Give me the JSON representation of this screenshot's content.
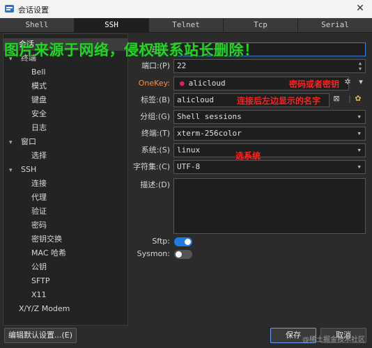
{
  "window": {
    "title": "会话设置",
    "close": "✕"
  },
  "tabs": [
    {
      "label": "Shell",
      "active": false
    },
    {
      "label": "SSH",
      "active": true
    },
    {
      "label": "Telnet",
      "active": false
    },
    {
      "label": "Tcp",
      "active": false
    },
    {
      "label": "Serial",
      "active": false
    }
  ],
  "tree": {
    "session": "会话",
    "terminal": "终端",
    "terminal_children": [
      "Bell",
      "模式",
      "键盘",
      "安全",
      "日志"
    ],
    "window": "窗口",
    "window_children": [
      "选择"
    ],
    "ssh": "SSH",
    "ssh_children": [
      "连接",
      "代理",
      "验证",
      "密码",
      "密钥交换",
      "MAC 哈希",
      "公钥",
      "SFTP",
      "X11"
    ],
    "xyz": "X/Y/Z Modem"
  },
  "form": {
    "host_label": "主机:",
    "host_value": "",
    "port_label": "端口:(P)",
    "port_value": "22",
    "onekey_label": "OneKey:",
    "onekey_value": "alicloud",
    "tag_label": "标签:(B)",
    "tag_value": "alicloud",
    "group_label": "分组:(G)",
    "group_value": "Shell sessions",
    "terminal_label": "终端:(T)",
    "terminal_value": "xterm-256color",
    "system_label": "系统:(S)",
    "system_value": "linux",
    "charset_label": "字符集:(C)",
    "charset_value": "UTF-8",
    "desc_label": "描述:(D)",
    "desc_value": "",
    "sftp_label": "Sftp:",
    "sftp_on": true,
    "sysmon_label": "Sysmon:",
    "sysmon_on": false
  },
  "annotations": {
    "key_note": "密码或者密钥",
    "tag_note": "连接后左边显示的名字",
    "system_note": "选系统"
  },
  "watermark": "图片来源于网络，侵权联系站长删除！",
  "footer_watermark": "@稀土掘金技术社区",
  "buttons": {
    "edit_defaults": "编辑默认设置...(E)",
    "save": "保存",
    "cancel": "取消"
  },
  "colors": {
    "toggle_on": "#1e7be0",
    "toggle_off": "#555555",
    "accent_label": "#ff8c3b",
    "annotation": "#ff2020",
    "watermark": "#27d02b"
  }
}
